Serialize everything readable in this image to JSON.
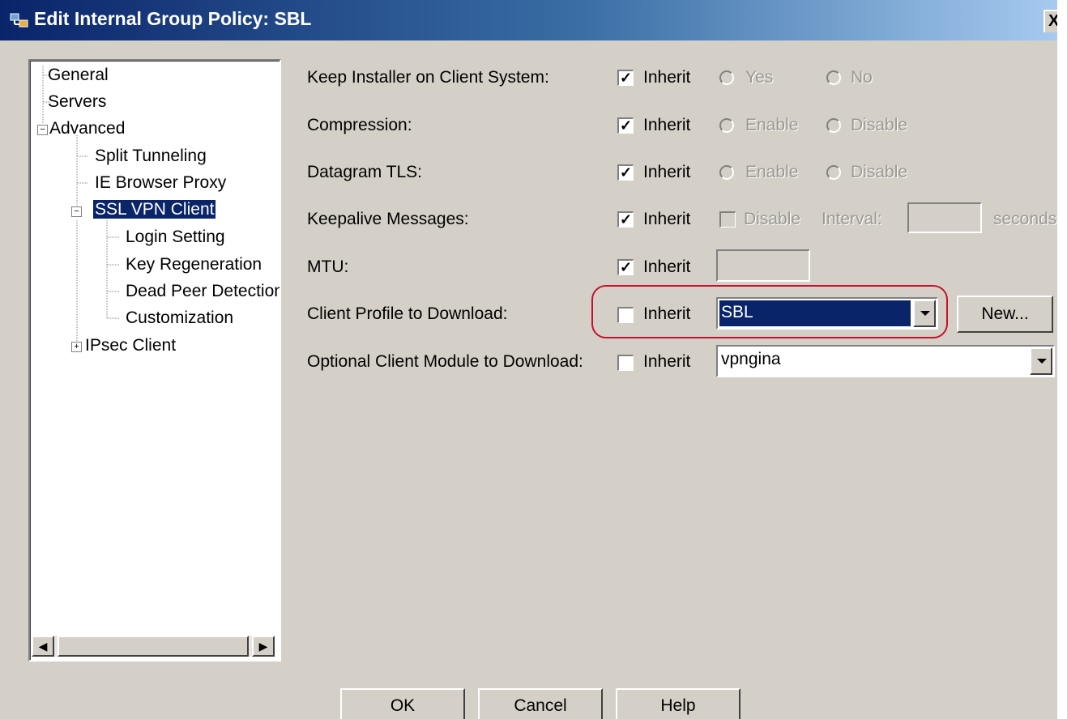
{
  "window": {
    "title": "Edit Internal Group Policy: SBL",
    "close_label": "X"
  },
  "tree": {
    "items": [
      {
        "label": "General"
      },
      {
        "label": "Servers"
      },
      {
        "label": "Advanced"
      },
      {
        "label": "Split Tunneling"
      },
      {
        "label": "IE Browser Proxy"
      },
      {
        "label": "SSL VPN Client"
      },
      {
        "label": "Login Setting"
      },
      {
        "label": "Key Regeneration"
      },
      {
        "label": "Dead Peer Detection"
      },
      {
        "label": "Customization"
      },
      {
        "label": "IPsec Client"
      }
    ],
    "selected": "SSL VPN Client"
  },
  "form": {
    "rows": [
      {
        "label": "Keep Installer on Client System:",
        "inherit": "Inherit",
        "opt1": "Yes",
        "opt2": "No"
      },
      {
        "label": "Compression:",
        "inherit": "Inherit",
        "opt1": "Enable",
        "opt2": "Disable"
      },
      {
        "label": "Datagram TLS:",
        "inherit": "Inherit",
        "opt1": "Enable",
        "opt2": "Disable"
      },
      {
        "label": "Keepalive Messages:",
        "inherit": "Inherit",
        "opt1": "Disable",
        "interval_label": "Interval:",
        "seconds_label": "seconds"
      },
      {
        "label": "MTU:",
        "inherit": "Inherit"
      },
      {
        "label": "Client Profile to Download:",
        "inherit": "Inherit",
        "value": "SBL",
        "new_label": "New..."
      },
      {
        "label": "Optional Client Module to Download:",
        "inherit": "Inherit",
        "value": "vpngina"
      }
    ]
  },
  "buttons": {
    "ok": "OK",
    "cancel": "Cancel",
    "help": "Help"
  },
  "colors": {
    "title_start": "#0a246a",
    "title_end": "#a6caf0",
    "highlight": "#c8102e",
    "selection": "#0a246a",
    "face": "#d4d0c8"
  }
}
